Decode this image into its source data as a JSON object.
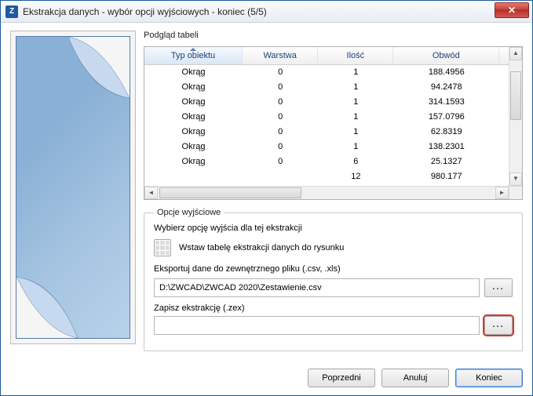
{
  "window": {
    "title": "Ekstrakcja danych - wybór opcji wyjściowych - koniec (5/5)"
  },
  "table": {
    "caption": "Podgląd tabeli",
    "headers": {
      "type": "Typ obiektu",
      "layer": "Warstwa",
      "count": "Ilość",
      "perimeter": "Obwód"
    },
    "rows": [
      {
        "type": "Okrąg",
        "layer": "0",
        "count": "1",
        "perimeter": "188.4956"
      },
      {
        "type": "Okrąg",
        "layer": "0",
        "count": "1",
        "perimeter": "94.2478"
      },
      {
        "type": "Okrąg",
        "layer": "0",
        "count": "1",
        "perimeter": "314.1593"
      },
      {
        "type": "Okrąg",
        "layer": "0",
        "count": "1",
        "perimeter": "157.0796"
      },
      {
        "type": "Okrąg",
        "layer": "0",
        "count": "1",
        "perimeter": "62.8319"
      },
      {
        "type": "Okrąg",
        "layer": "0",
        "count": "1",
        "perimeter": "138.2301"
      },
      {
        "type": "Okrąg",
        "layer": "0",
        "count": "6",
        "perimeter": "25.1327"
      },
      {
        "type": "",
        "layer": "",
        "count": "12",
        "perimeter": "980.177"
      }
    ]
  },
  "output_group": {
    "legend": "Opcje wyjściowe",
    "choose_label": "Wybierz opcję wyjścia dla tej ekstrakcji",
    "insert_label": "Wstaw tabelę ekstrakcji danych do rysunku",
    "export_label": "Eksportuj dane do zewnętrznego pliku (.csv, .xls)",
    "export_path": "D:\\ZWCAD\\ZWCAD 2020\\Zestawienie.csv",
    "browse_label": "...",
    "zex_label": "Zapisz ekstrakcję (.zex)",
    "zex_path": "",
    "zex_browse_label": "..."
  },
  "buttons": {
    "prev": "Poprzedni",
    "cancel": "Anuluj",
    "finish": "Koniec"
  }
}
